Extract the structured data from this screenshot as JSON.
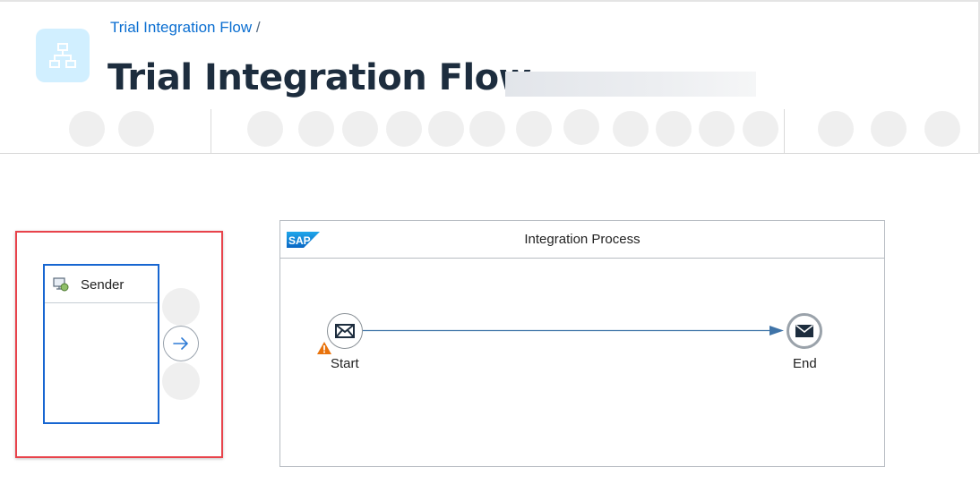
{
  "header": {
    "breadcrumb": {
      "link": "Trial Integration Flow",
      "separator": "/"
    },
    "title": "Trial Integration Flow",
    "app_icon": "network-hierarchy-icon"
  },
  "toolbar": {
    "left_group_count": 2,
    "middle_group_count": 12,
    "right_group_count": 3
  },
  "canvas": {
    "sender": {
      "label": "Sender",
      "icon": "sender-system-icon"
    },
    "integration_process": {
      "title": "Integration Process",
      "logo": "SAP",
      "start_event": {
        "label": "Start",
        "icon": "envelope-icon",
        "warning_icon": "warning-triangle-icon"
      },
      "end_event": {
        "label": "End",
        "icon": "envelope-filled-icon"
      }
    }
  },
  "colors": {
    "accent": "#0a6ed1",
    "title": "#1d2d3e",
    "highlight": "#e8434b",
    "selection": "#1766d1",
    "warning": "#e9730c",
    "flow": "#3f74a8"
  }
}
